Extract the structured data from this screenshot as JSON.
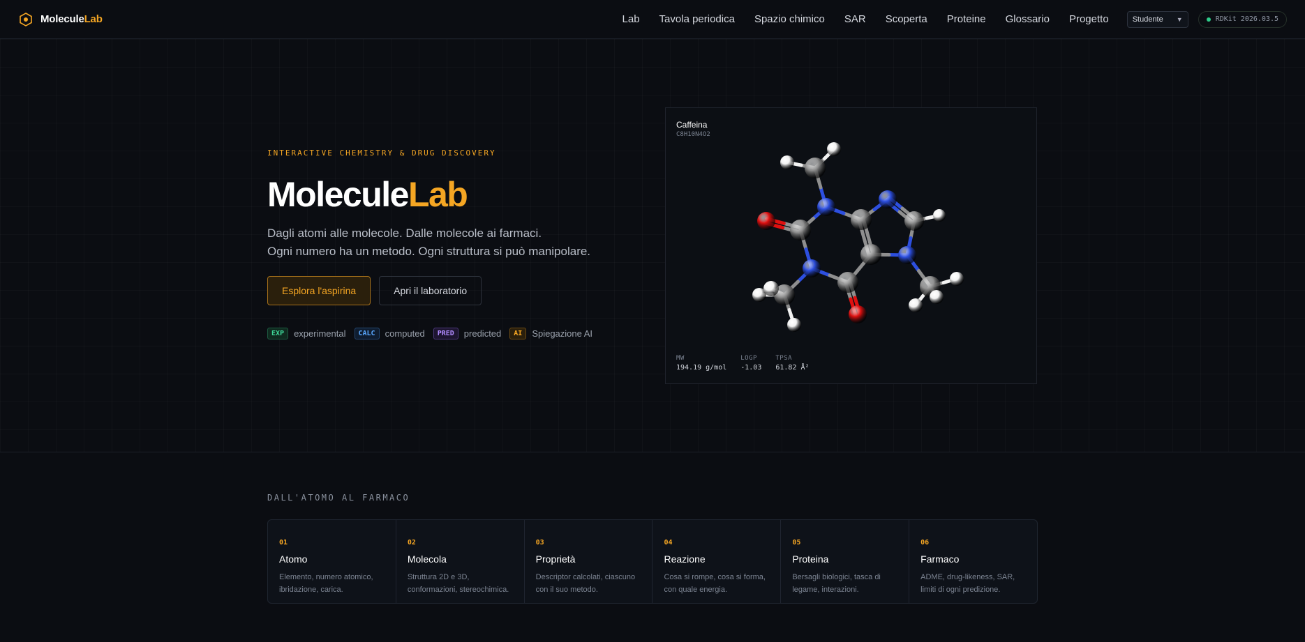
{
  "nav": {
    "logo_main": "Molecule",
    "logo_accent": "Lab",
    "links": [
      "Lab",
      "Tavola periodica",
      "Spazio chimico",
      "SAR",
      "Scoperta",
      "Proteine",
      "Glossario",
      "Progetto"
    ],
    "role_select": "Studente",
    "engine_badge": "RDKit 2026.03.5"
  },
  "hero": {
    "eyebrow": "INTERACTIVE CHEMISTRY & DRUG DISCOVERY",
    "title_main": "Molecule",
    "title_accent": "Lab",
    "subtitle_1": "Dagli atomi alle molecole. Dalle molecole ai farmaci.",
    "subtitle_2": "Ogni numero ha un metodo. Ogni struttura si può manipolare.",
    "primary_button": "Esplora l'aspirina",
    "secondary_button": "Apri il laboratorio",
    "legend": [
      {
        "tag": "EXP",
        "label": "experimental"
      },
      {
        "tag": "CALC",
        "label": "computed"
      },
      {
        "tag": "PRED",
        "label": "predicted"
      },
      {
        "tag": "AI",
        "label": "Spiegazione AI"
      }
    ]
  },
  "molecule": {
    "name": "Caffeina",
    "formula": "C8H10N4O2",
    "properties": [
      {
        "key": "MW",
        "value": "194.19 g/mol"
      },
      {
        "key": "LOGP",
        "value": "-1.03"
      },
      {
        "key": "TPSA",
        "value": "61.82 Å²"
      }
    ],
    "atom_colors": {
      "C": "#8f8f8f",
      "N": "#2d4fe0",
      "O": "#e01010",
      "H": "#f2f2f2"
    }
  },
  "pipeline": {
    "title": "DALL'ATOMO AL FARMACO",
    "steps": [
      {
        "num": "01",
        "title": "Atomo",
        "desc_1": "Elemento, numero atomico,",
        "desc_2": "ibridazione, carica."
      },
      {
        "num": "02",
        "title": "Molecola",
        "desc_1": "Struttura 2D e 3D,",
        "desc_2": "conformazioni, stereochimica."
      },
      {
        "num": "03",
        "title": "Proprietà",
        "desc_1": "Descriptor calcolati, ciascuno",
        "desc_2": "con il suo metodo."
      },
      {
        "num": "04",
        "title": "Reazione",
        "desc_1": "Cosa si rompe, cosa si forma,",
        "desc_2": "con quale energia."
      },
      {
        "num": "05",
        "title": "Proteina",
        "desc_1": "Bersagli biologici, tasca di",
        "desc_2": "legame, interazioni."
      },
      {
        "num": "06",
        "title": "Farmaco",
        "desc_1": "ADME, drug-likeness, SAR,",
        "desc_2": "limiti di ogni predizione."
      }
    ]
  }
}
